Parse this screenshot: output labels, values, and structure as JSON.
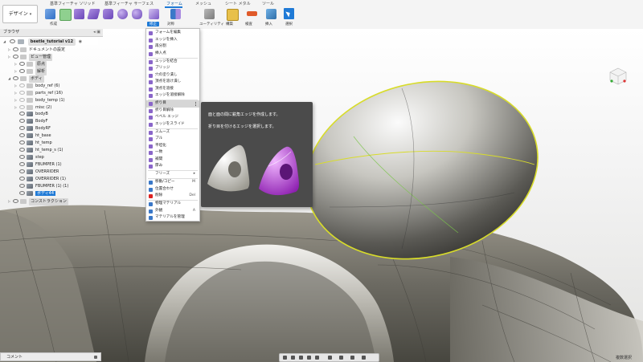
{
  "workspace": {
    "label": "デザイン"
  },
  "tabs": [
    {
      "label": "基準フィーチャ ソリッド",
      "active": false
    },
    {
      "label": "基準フィーチャ サーフェス",
      "active": false
    },
    {
      "label": "フォーム",
      "active": true
    },
    {
      "label": "メッシュ",
      "active": false
    },
    {
      "label": "シート メタル",
      "active": false
    },
    {
      "label": "ツール",
      "active": false
    }
  ],
  "toolbar_groups": [
    {
      "label": "作成",
      "active": false
    },
    {
      "label": "修正",
      "active": true
    },
    {
      "label": "対称",
      "active": false
    },
    {
      "label": "ユーティリティ",
      "active": false
    },
    {
      "label": "構築",
      "active": false
    },
    {
      "label": "検査",
      "active": false
    },
    {
      "label": "挿入",
      "active": false
    },
    {
      "label": "選択",
      "active": false
    }
  ],
  "browser": {
    "title": "ブラウザ",
    "root": "beetle_tutorial v12",
    "items": [
      {
        "label": "ドキュメントの設定",
        "type": "gear"
      },
      {
        "label": "ビュー管理",
        "type": "folder"
      },
      {
        "label": "原点",
        "type": "folder"
      },
      {
        "label": "解析",
        "type": "folder"
      },
      {
        "label": "ボディ",
        "type": "folder"
      },
      {
        "label": "body_ref (6)",
        "type": "group"
      },
      {
        "label": "parts_ref (16)",
        "type": "group"
      },
      {
        "label": "body_temp (1)",
        "type": "group"
      },
      {
        "label": "misc (2)",
        "type": "group"
      },
      {
        "label": "bodyB",
        "type": "body"
      },
      {
        "label": "BodyF",
        "type": "body"
      },
      {
        "label": "BodyRF",
        "type": "body"
      },
      {
        "label": "ht_base",
        "type": "body"
      },
      {
        "label": "ht_temp",
        "type": "body"
      },
      {
        "label": "ht_temp_s (1)",
        "type": "body"
      },
      {
        "label": "step",
        "type": "body"
      },
      {
        "label": "FBUMPER (1)",
        "type": "body"
      },
      {
        "label": "OVERRIDER",
        "type": "body"
      },
      {
        "label": "OVERRIDER (1)",
        "type": "body"
      },
      {
        "label": "FBUMPER (1) (1)",
        "type": "body"
      },
      {
        "label": "ボディ44",
        "type": "body"
      },
      {
        "label": "コンストラクション",
        "type": "folder"
      }
    ]
  },
  "menu": {
    "items": [
      {
        "label": "フォームを編集",
        "shortcut": ""
      },
      {
        "label": "エッジを挿入",
        "shortcut": ""
      },
      {
        "label": "再分割",
        "shortcut": ""
      },
      {
        "label": "挿入点",
        "shortcut": ""
      },
      {
        "label": "エッジを結合",
        "shortcut": ""
      },
      {
        "label": "ブリッジ",
        "shortcut": ""
      },
      {
        "label": "穴の塗り潰し",
        "shortcut": ""
      },
      {
        "label": "頂点を溶け潰し",
        "shortcut": ""
      },
      {
        "label": "頂点を溶接",
        "shortcut": ""
      },
      {
        "label": "エッジを溶接解除",
        "shortcut": ""
      },
      {
        "label": "折り目",
        "shortcut": "",
        "hover": true
      },
      {
        "label": "折り目解除",
        "shortcut": ""
      },
      {
        "label": "ベベル エッジ",
        "shortcut": ""
      },
      {
        "label": "エッジをスライド",
        "shortcut": ""
      },
      {
        "label": "スムーズ",
        "shortcut": ""
      },
      {
        "label": "プル",
        "shortcut": ""
      },
      {
        "label": "平坦化",
        "shortcut": ""
      },
      {
        "label": "一致",
        "shortcut": ""
      },
      {
        "label": "補間",
        "shortcut": ""
      },
      {
        "label": "厚み",
        "shortcut": ""
      },
      {
        "label": "フリーズ",
        "shortcut": "",
        "submenu": true
      },
      {
        "label": "移動/コピー",
        "shortcut": "M"
      },
      {
        "label": "位置合わせ",
        "shortcut": ""
      },
      {
        "label": "削除",
        "shortcut": "Del",
        "red": true
      },
      {
        "label": "物理マテリアル",
        "shortcut": ""
      },
      {
        "label": "外観",
        "shortcut": "A"
      },
      {
        "label": "マテリアルを管理",
        "shortcut": ""
      }
    ]
  },
  "tooltip": {
    "line1": "面と面の間に鋭角エッジを作成します。",
    "line2": "折り目を付けるエッジを選択します。"
  },
  "comments": {
    "label": "コメント"
  },
  "status": {
    "label": "複数選択"
  },
  "colors": {
    "accent": "#1f7ad6",
    "selection_edge": "#d8dc2a",
    "highlight_body": "#b04ccc"
  }
}
